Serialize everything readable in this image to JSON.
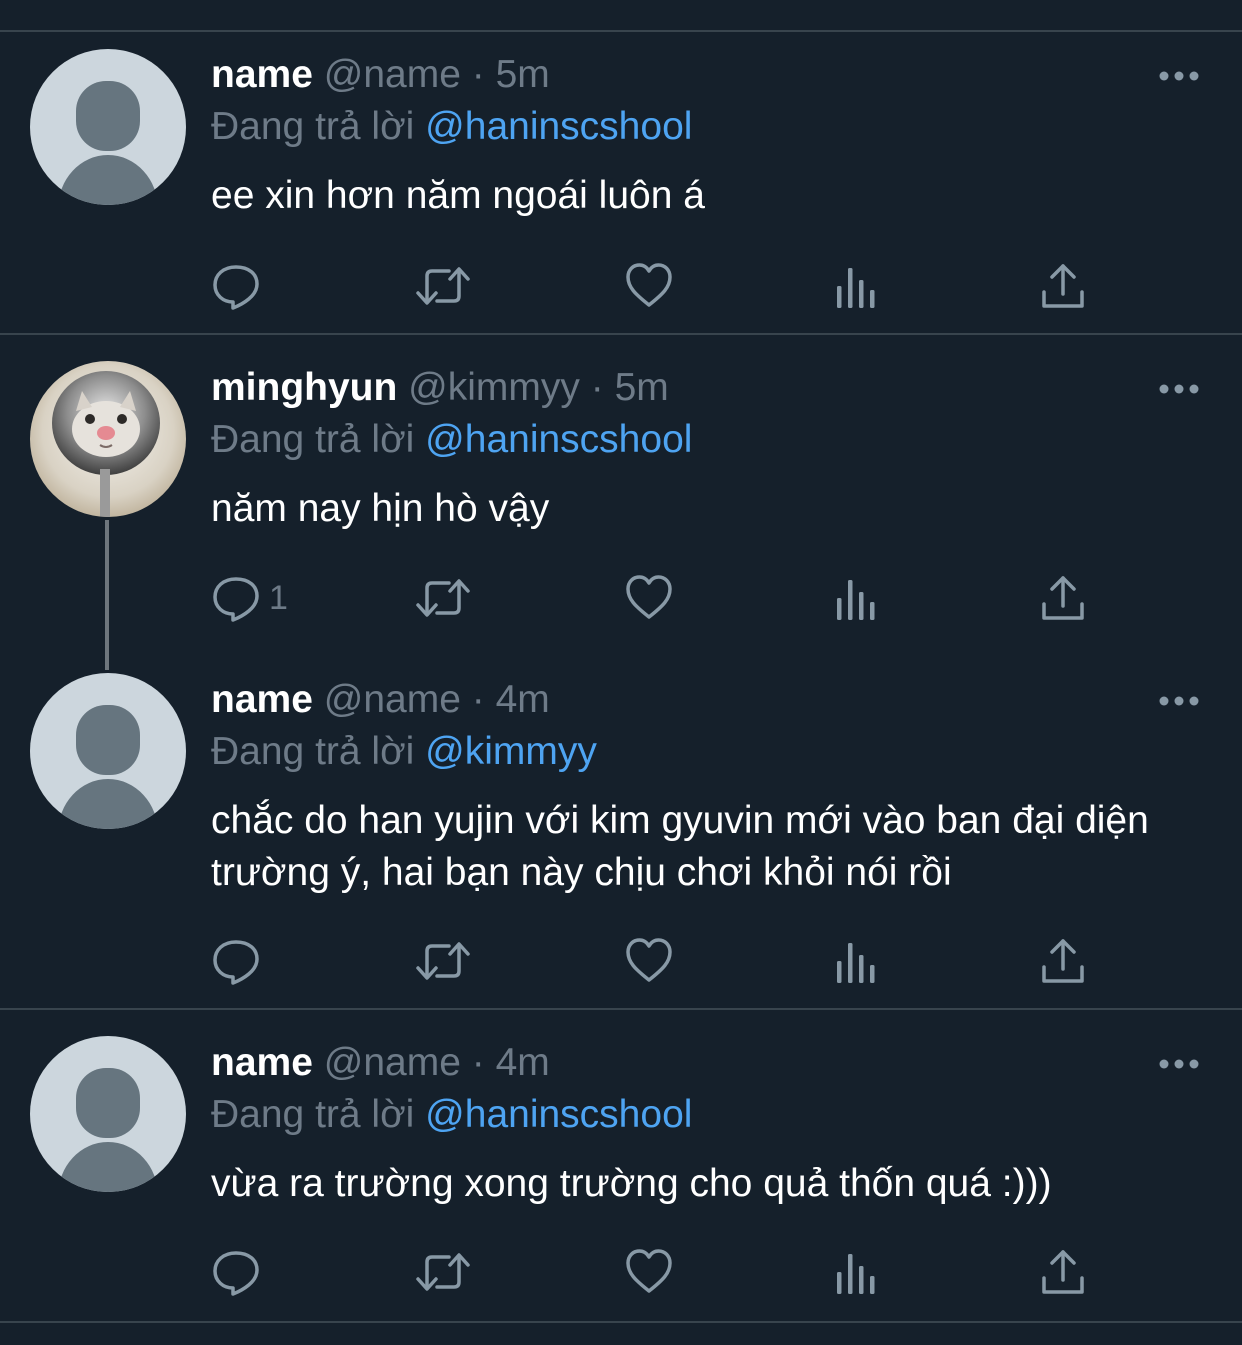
{
  "tweets": [
    {
      "display_name": "name",
      "handle": "@name",
      "separator": "·",
      "time": "5m",
      "reply_prefix": "Đang trả lời",
      "reply_to": "@haninscshool",
      "text": "ee xin hơn năm ngoái luôn á",
      "reply_count": ""
    },
    {
      "display_name": "minghyun",
      "handle": "@kimmyy",
      "separator": "·",
      "time": "5m",
      "reply_prefix": "Đang trả lời",
      "reply_to": "@haninscshool",
      "text": "năm nay hịn hò vậy",
      "reply_count": "1"
    },
    {
      "display_name": "name",
      "handle": "@name",
      "separator": "·",
      "time": "4m",
      "reply_prefix": "Đang trả lời",
      "reply_to": "@kimmyy",
      "text": "chắc do han yujin với kim gyuvin mới vào ban đại diện trường ý, hai bạn này chịu chơi khỏi nói rồi",
      "reply_count": ""
    },
    {
      "display_name": "name",
      "handle": "@name",
      "separator": "·",
      "time": "4m",
      "reply_prefix": "Đang trả lời",
      "reply_to": "@haninscshool",
      "text": "vừa ra trường xong trường cho quả thốn quá :)))",
      "reply_count": ""
    }
  ],
  "icons": [
    "reply-icon",
    "retweet-icon",
    "like-icon",
    "analytics-icon",
    "share-icon",
    "more-icon"
  ],
  "colors": {
    "background": "#15202b",
    "divider": "#38444d",
    "muted": "#6e7b88",
    "mention": "#4ea4f2",
    "text": "#ffffff"
  }
}
